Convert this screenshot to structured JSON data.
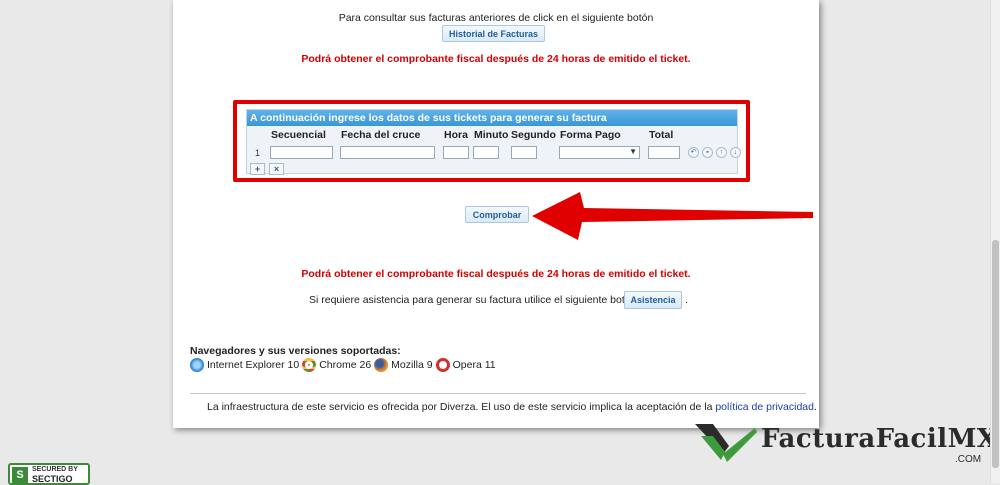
{
  "header": {
    "history_text": "Para consultar sus facturas anteriores de click en el siguiente botón",
    "history_button": "Historial de Facturas",
    "notice_top": "Podrá obtener el comprobante fiscal después de 24 horas de emitido el ticket."
  },
  "grid": {
    "caption": "A continuación ingrese los datos de sus tickets para generar su factura",
    "columns": [
      "Secuencial",
      "Fecha del cruce",
      "Hora",
      "Minuto",
      "Segundo",
      "Forma Pago",
      "Total"
    ],
    "rows": [
      {
        "num": "1",
        "secuencial": "",
        "fecha": "",
        "hora": "",
        "minuto": "",
        "segundo": "",
        "forma_pago": "",
        "total": ""
      }
    ],
    "add_label": "+",
    "delete_label": "×"
  },
  "actions": {
    "comprobar": "Comprobar"
  },
  "notice_bottom": "Podrá obtener el comprobante fiscal después de 24 horas de emitido el ticket.",
  "assist": {
    "text": "Si requiere asistencia para generar su factura utilice el siguiente botón",
    "button": "Asistencia",
    "trail": "."
  },
  "browsers": {
    "title": "Navegadores y sus versiones soportadas:",
    "items": [
      {
        "name": "Internet Explorer 10",
        "icon": "ie-icon"
      },
      {
        "name": "Chrome 26",
        "icon": "chrome-icon"
      },
      {
        "name": "Mozilla 9",
        "icon": "firefox-icon"
      },
      {
        "name": "Opera 11",
        "icon": "opera-icon"
      }
    ]
  },
  "footer": {
    "text": "La infraestructura de este servicio es ofrecida por Diverza. El uso de este servicio implica la aceptación de la",
    "link": "política de privacidad",
    "end": "."
  },
  "watermark": {
    "brand": "FacturaFacilMX",
    "suffix": ".COM"
  },
  "badge": {
    "line1": "SECURED BY",
    "line2": "SECTIGO"
  },
  "colors": {
    "accent_red": "#e10000",
    "warning_red": "#d40000",
    "grid_header_blue": "#3a97d8",
    "link_blue": "#1a3fa8",
    "brand_dark": "#2b2b2b",
    "brand_green": "#3d9b3d"
  }
}
